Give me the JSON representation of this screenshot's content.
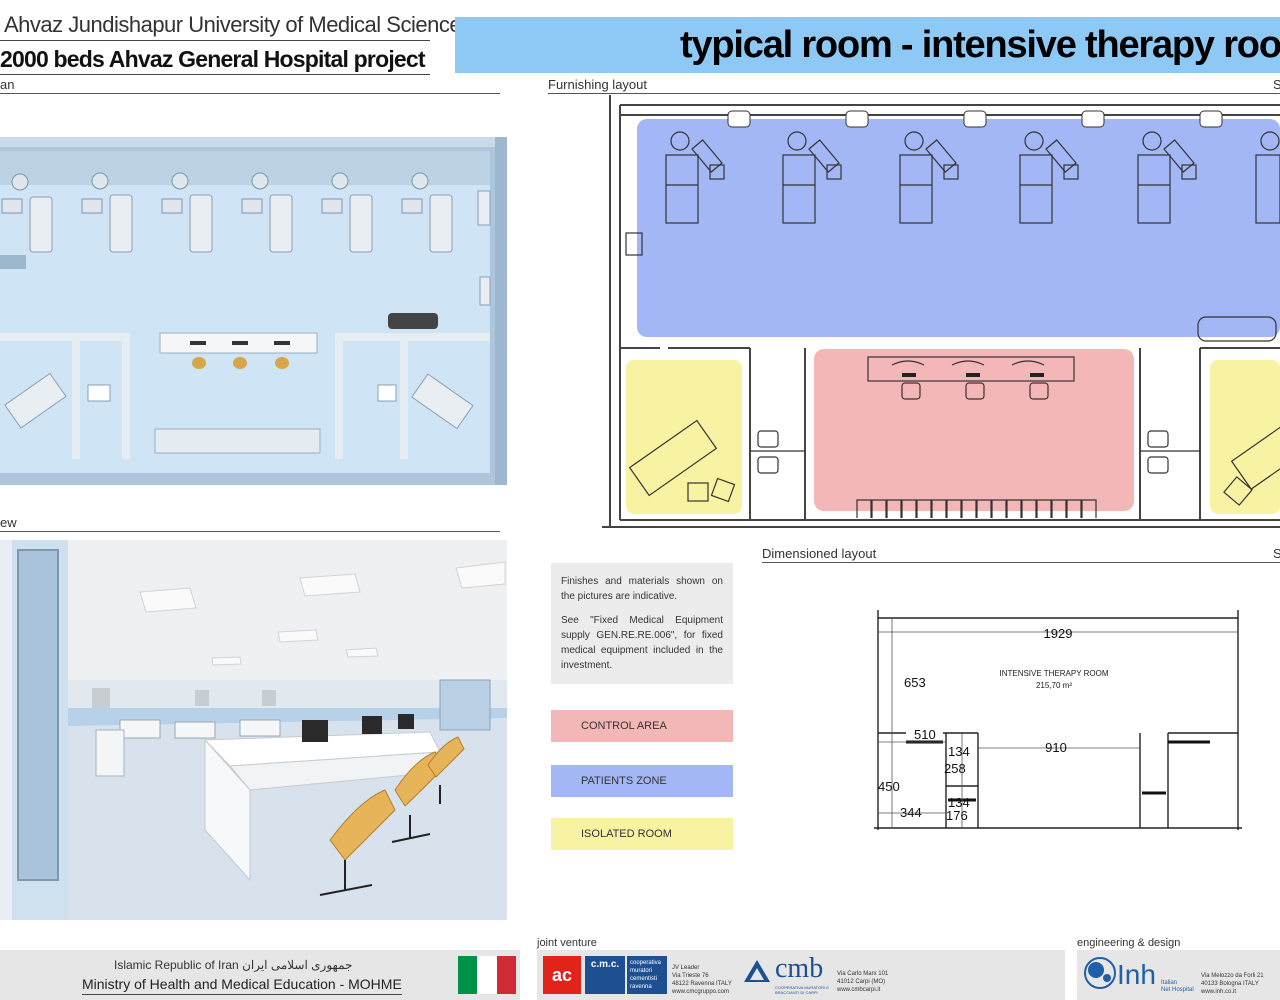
{
  "header": {
    "university": "Ahvaz Jundishapur University of Medical Sciences",
    "project": "2000 beds Ahvaz General Hospital project",
    "title": "typical room  - intensive therapy roo"
  },
  "sections": {
    "plan_label": "an",
    "view_label": "ew",
    "furnishing_label": "Furnishing layout",
    "furnishing_scale": "S",
    "dimensioned_label": "Dimensioned layout",
    "dimensioned_scale": "S"
  },
  "notes": {
    "line1": "Finishes and materials  shown on the pictures are indicative.",
    "line2": "See \"Fixed Medical Equipment supply GEN.RE.RE.006\", for  fixed medical equipment included in the investment."
  },
  "legend": [
    {
      "label": "CONTROL AREA",
      "color": "#f4b7b7"
    },
    {
      "label": "PATIENTS ZONE",
      "color": "#a3b6f5"
    },
    {
      "label": "ISOLATED ROOM",
      "color": "#f8f2a3"
    }
  ],
  "dimensions": {
    "width_total": "1929",
    "depth_patients": "653",
    "room_name": "INTENSIVE THERAPY ROOM",
    "room_area": "215,70 m²",
    "iso_width": "510",
    "control_width": "910",
    "iso_depth": "450",
    "iso_sub": "344",
    "wc_a": "134",
    "wc_b": "258",
    "wc_c": "134",
    "wc_d": "176"
  },
  "footer": {
    "country": "Islamic Republic of Iran",
    "country_farsi": "جمهوری اسلامی ایران",
    "ministry": "Ministry of Health and Medical Education - MOHME",
    "joint_venture": "joint venture",
    "engineering": "engineering & design",
    "cmc_logo": "c.m.c.",
    "cmc_name": "cooperativa muratori cementisti ravenna",
    "cmc_address1": "JV Leader",
    "cmc_address2": "Via Trieste 76",
    "cmc_address3": "48122 Ravenna ITALY",
    "cmc_address4": "www.cmcgruppo.com",
    "cmb_logo": "cmb",
    "cmb_name": "COOPERATIVA MURATORI E BRACCIANTI DI CARPI",
    "cmb_address1": "Via Carlo Marx 101",
    "cmb_address2": "41012 Carpi (MO)",
    "cmb_address3": "www.cmbcarpi.it",
    "inh_logo": "Inh",
    "inh_name1": "Italian",
    "inh_name2": "Net Hospital",
    "inh_address1": "Via Melozzo da Forli 21",
    "inh_address2": "40133 Bologna ITALY",
    "inh_address3": "www.inh.co.it"
  },
  "colors": {
    "title_band": "#8ec9f5",
    "flag_green": "#009246",
    "flag_white": "#ffffff",
    "flag_red": "#ce2b37",
    "cmc_red": "#e2231a",
    "cmc_blue": "#1d4f91",
    "inh_blue": "#1f5fa8"
  }
}
